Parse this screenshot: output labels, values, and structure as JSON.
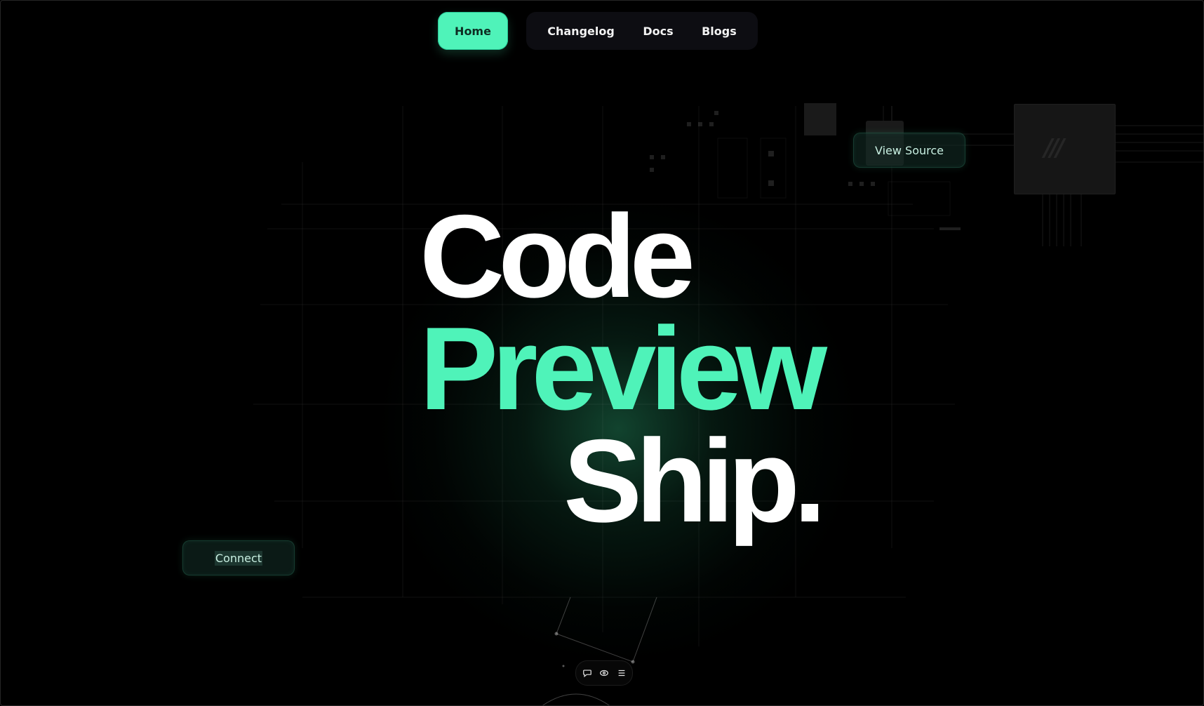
{
  "nav": {
    "home": "Home",
    "links": [
      "Changelog",
      "Docs",
      "Blogs"
    ]
  },
  "headline": {
    "line1": "Code",
    "line2": "Preview",
    "line3": "Ship."
  },
  "buttons": {
    "view_source": "View Source",
    "connect": "Connect"
  },
  "toolbar": {
    "icons": [
      "chat-icon",
      "eye-icon",
      "menu-icon"
    ]
  },
  "colors": {
    "accent": "#4ff3b9",
    "background": "#000000",
    "text": "#ffffff"
  }
}
